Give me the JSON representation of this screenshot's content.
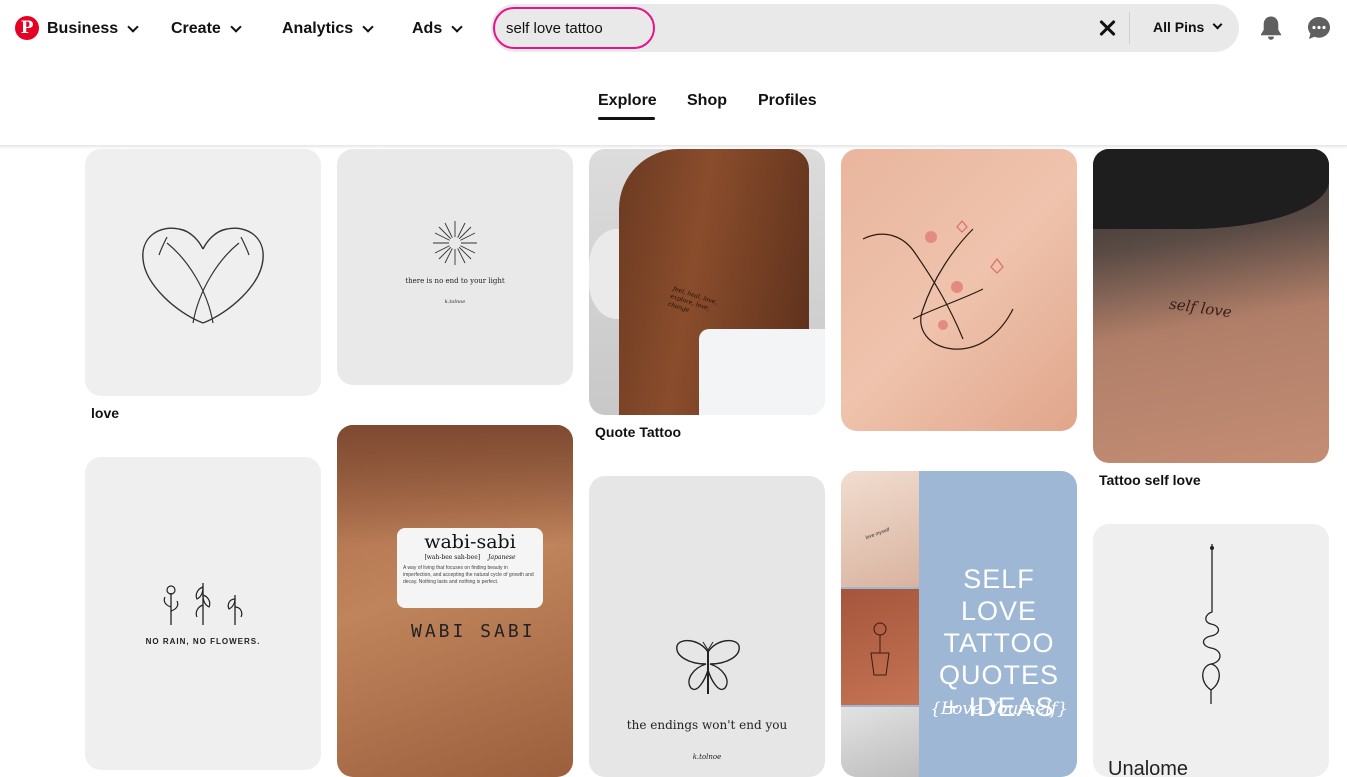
{
  "nav": {
    "logo_letter": "P",
    "items": [
      {
        "label": "Business"
      },
      {
        "label": "Create"
      },
      {
        "label": "Analytics"
      },
      {
        "label": "Ads"
      }
    ]
  },
  "search": {
    "query": "self love tattoo",
    "filter_label": "All Pins"
  },
  "tabs": [
    {
      "label": "Explore",
      "active": true
    },
    {
      "label": "Shop",
      "active": false
    },
    {
      "label": "Profiles",
      "active": false
    }
  ],
  "pins": {
    "heart_hug": {
      "title": "love"
    },
    "light": {
      "caption": "there is no end to your light",
      "signature": "k.tolnoe"
    },
    "quote_tattoo": {
      "title": "Quote Tattoo",
      "arm_text": "feel, heal, love, explore, love, change"
    },
    "butterfly_arms": {},
    "self_love_script": {
      "title": "Tattoo self love",
      "arm_text": "self love"
    },
    "no_rain": {
      "caption": "NO RAIN, NO FLOWERS."
    },
    "wabi_sabi": {
      "heading": "wabi-sabi",
      "phonetic": "[wah-bee sah-bee]",
      "language": "Japanese",
      "definition": "A way of living that focuses on finding beauty in imperfection, and accepting the natural cycle of growth and decay. Nothing lasts and nothing is perfect.",
      "tattoo": "WABI SABI"
    },
    "endings": {
      "caption": "the endings won't end you",
      "signature": "k.tolnoe"
    },
    "collage": {
      "lines": [
        "SELF LOVE",
        "TATTOO",
        "QUOTES",
        "+ IDEAS"
      ],
      "script": "{Love Yourself}",
      "small_tattoo": "love myself"
    },
    "unalome": {
      "caption": "Unalome"
    }
  },
  "colors": {
    "brand_red": "#e60023",
    "search_highlight": "#e7138a",
    "collage_blue": "#9eb7d4"
  },
  "icons": [
    "pinterest-logo-icon",
    "chevron-down-icon",
    "clear-icon",
    "bell-icon",
    "chat-icon"
  ]
}
